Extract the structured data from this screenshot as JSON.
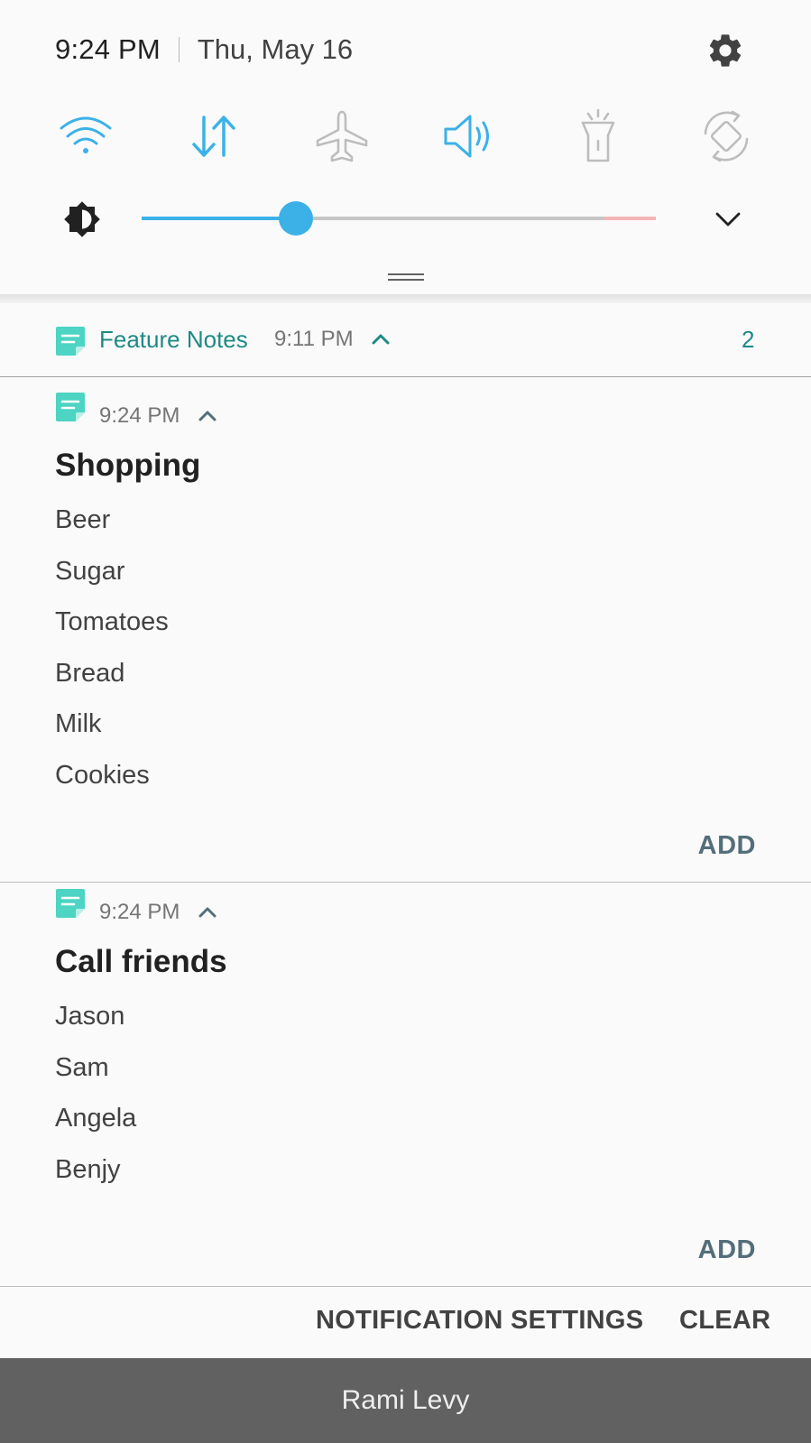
{
  "status": {
    "time": "9:24 PM",
    "date": "Thu, May 16"
  },
  "quick_toggles": [
    {
      "name": "wifi",
      "icon": "wifi-icon",
      "active": true
    },
    {
      "name": "mobile-data",
      "icon": "data-arrows-icon",
      "active": true
    },
    {
      "name": "airplane-mode",
      "icon": "airplane-icon",
      "active": false
    },
    {
      "name": "sound",
      "icon": "sound-icon",
      "active": true
    },
    {
      "name": "flashlight",
      "icon": "flashlight-icon",
      "active": false
    },
    {
      "name": "auto-rotate",
      "icon": "rotate-icon",
      "active": false
    }
  ],
  "brightness": {
    "level": 0.3
  },
  "colors": {
    "accent": "#3bb1e8",
    "app_teal": "#1e8a84",
    "app_icon": "#4dd4c3",
    "inactive": "#c0c0c0"
  },
  "group": {
    "app_name": "Feature Notes",
    "time": "9:11 PM",
    "count": "2"
  },
  "notes": [
    {
      "time": "9:24 PM",
      "title": "Shopping",
      "items": [
        "Beer",
        "Sugar",
        "Tomatoes",
        "Bread",
        "Milk",
        "Cookies"
      ],
      "action": "ADD"
    },
    {
      "time": "9:24 PM",
      "title": "Call friends",
      "items": [
        "Jason",
        "Sam",
        "Angela",
        "Benjy"
      ],
      "action": "ADD"
    }
  ],
  "actions": {
    "settings": "NOTIFICATION SETTINGS",
    "clear": "CLEAR"
  },
  "carrier": "Rami Levy"
}
